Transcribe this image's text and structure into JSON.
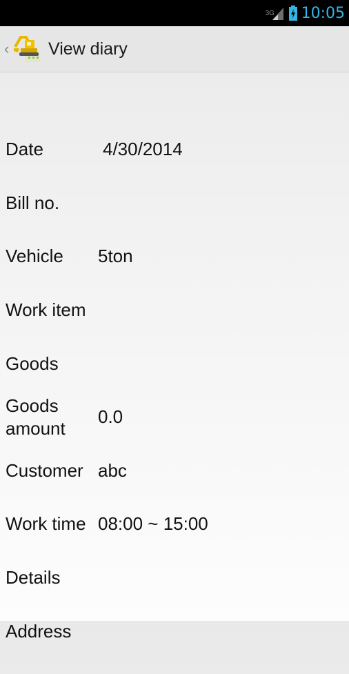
{
  "status_bar": {
    "network": "3G",
    "time": "10:05"
  },
  "action_bar": {
    "title": "View diary",
    "icon": "excavator-icon"
  },
  "fields": [
    {
      "label": "Date",
      "value": "4/30/2014"
    },
    {
      "label": "Bill no.",
      "value": ""
    },
    {
      "label": "Vehicle",
      "value": "5ton"
    },
    {
      "label": "Work item",
      "value": ""
    },
    {
      "label": "Goods",
      "value": ""
    },
    {
      "label": "Goods amount",
      "label_line1": "Goods",
      "label_line2": "amount",
      "value": "0.0"
    },
    {
      "label": "Customer",
      "value": "abc"
    },
    {
      "label": "Work time",
      "value": "08:00 ~ 15:00"
    },
    {
      "label": "Details",
      "value": ""
    },
    {
      "label": "Address",
      "value": ""
    }
  ],
  "colors": {
    "clock": "#33b5e5",
    "action_bar": "#e6e6e6",
    "status_bar": "#000000"
  }
}
